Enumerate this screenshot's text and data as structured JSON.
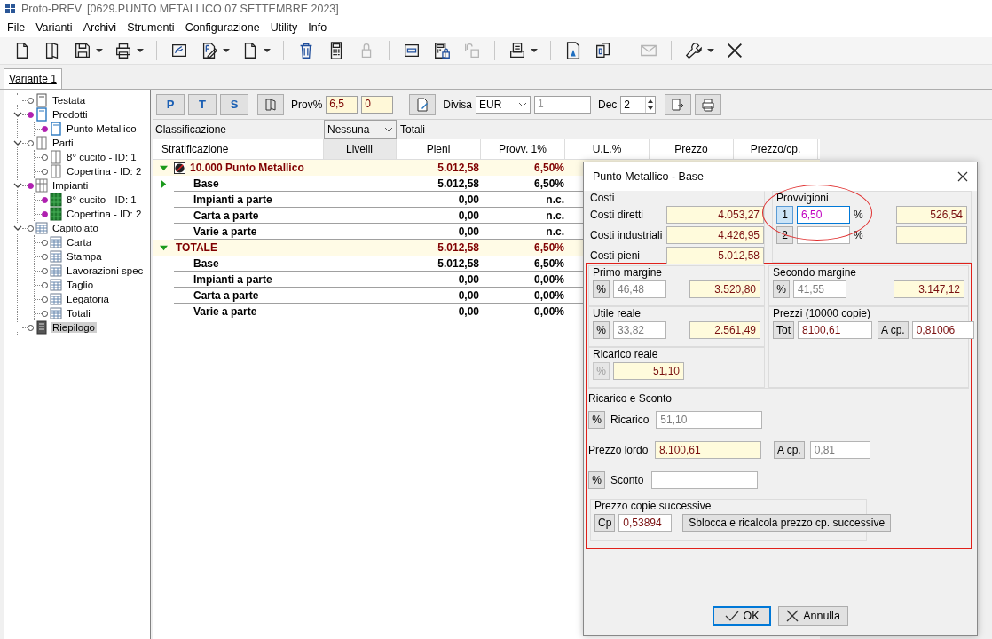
{
  "window": {
    "title": "Proto-PREV",
    "document": "[0629.PUNTO METALLICO 07 SETTEMBRE 2023]"
  },
  "menu": [
    "File",
    "Varianti",
    "Archivi",
    "Strumenti",
    "Configurazione",
    "Utility",
    "Info"
  ],
  "toolbar": [
    {
      "kind": "new",
      "dropdown": false,
      "disabled": false
    },
    {
      "kind": "template",
      "dropdown": false,
      "disabled": false
    },
    {
      "kind": "save",
      "dropdown": true,
      "disabled": false
    },
    {
      "kind": "print",
      "dropdown": true,
      "disabled": false
    },
    {
      "kind": "separator"
    },
    {
      "kind": "sign",
      "dropdown": false,
      "disabled": false
    },
    {
      "kind": "edit",
      "dropdown": true,
      "disabled": false
    },
    {
      "kind": "document",
      "dropdown": true,
      "disabled": false
    },
    {
      "kind": "separator"
    },
    {
      "kind": "trash",
      "dropdown": false,
      "disabled": false
    },
    {
      "kind": "calculator",
      "dropdown": false,
      "disabled": false
    },
    {
      "kind": "lock",
      "dropdown": false,
      "disabled": true
    },
    {
      "kind": "separator"
    },
    {
      "kind": "tag",
      "dropdown": false,
      "disabled": false
    },
    {
      "kind": "calc-lock",
      "dropdown": false,
      "disabled": false
    },
    {
      "kind": "unlock",
      "dropdown": false,
      "disabled": true
    },
    {
      "kind": "separator"
    },
    {
      "kind": "tray",
      "dropdown": true,
      "disabled": false
    },
    {
      "kind": "separator"
    },
    {
      "kind": "doc-mark",
      "dropdown": false,
      "disabled": false
    },
    {
      "kind": "copy",
      "dropdown": false,
      "disabled": false
    },
    {
      "kind": "separator"
    },
    {
      "kind": "mail",
      "dropdown": false,
      "disabled": true
    },
    {
      "kind": "separator"
    },
    {
      "kind": "wrench",
      "dropdown": true,
      "disabled": false
    },
    {
      "kind": "close",
      "dropdown": false,
      "disabled": false
    }
  ],
  "tabs": [
    {
      "label": "Variante 1",
      "selected": true
    }
  ],
  "tree": [
    {
      "label": "Testata",
      "kind": "page",
      "linked": false,
      "selected": false
    },
    {
      "label": "Prodotti",
      "kind": "book",
      "linked": true,
      "selected": false,
      "expanded": true,
      "children": [
        {
          "label": "Punto Metallico -",
          "kind": "book",
          "linked": true,
          "selected": false
        }
      ]
    },
    {
      "label": "Parti",
      "kind": "columns",
      "linked": false,
      "selected": false,
      "expanded": true,
      "children": [
        {
          "label": "8° cucito  - ID: 1",
          "kind": "columns",
          "linked": false,
          "selected": false
        },
        {
          "label": "Copertina - ID: 2",
          "kind": "columns",
          "linked": false,
          "selected": false
        }
      ]
    },
    {
      "label": "Impianti",
      "kind": "grid",
      "linked": true,
      "selected": false,
      "expanded": true,
      "children": [
        {
          "label": "8° cucito  - ID: 1",
          "kind": "green",
          "linked": true,
          "selected": false
        },
        {
          "label": "Copertina - ID: 2",
          "kind": "green",
          "linked": true,
          "selected": false
        }
      ]
    },
    {
      "label": "Capitolato",
      "kind": "table",
      "linked": false,
      "selected": false,
      "expanded": true,
      "children": [
        {
          "label": "Carta",
          "kind": "table",
          "linked": false,
          "selected": false
        },
        {
          "label": "Stampa",
          "kind": "table",
          "linked": false,
          "selected": false
        },
        {
          "label": "Lavorazioni spec",
          "kind": "table",
          "linked": false,
          "selected": false
        },
        {
          "label": "Taglio",
          "kind": "table",
          "linked": false,
          "selected": false
        },
        {
          "label": "Legatoria",
          "kind": "table",
          "linked": false,
          "selected": false
        },
        {
          "label": "Totali",
          "kind": "table",
          "linked": false,
          "selected": false
        }
      ]
    },
    {
      "label": "Riepilogo",
      "kind": "summary",
      "linked": false,
      "selected": true
    }
  ],
  "panel_toolbar": {
    "view_buttons": [
      "P",
      "T",
      "S"
    ],
    "prov_label": "Prov%",
    "prov_values": [
      "6,5",
      "0"
    ],
    "currency_label": "Divisa",
    "currency": "EUR",
    "rate": "1",
    "decimals_label": "Dec",
    "decimals": "2"
  },
  "classification": {
    "label": "Classificazione",
    "value": "Nessuna",
    "mode": "Totali"
  },
  "table": {
    "columns": [
      {
        "label": "Stratificazione",
        "selected": false
      },
      {
        "label": "Livelli",
        "selected": true
      },
      {
        "label": "Pieni",
        "selected": false
      },
      {
        "label": "Provv. 1%",
        "selected": false
      },
      {
        "label": "U.L.%",
        "selected": false
      },
      {
        "label": "Prezzo",
        "selected": false
      },
      {
        "label": "Prezzo/cp.",
        "selected": false
      }
    ],
    "rows": [
      {
        "kind": "group",
        "label": "10.000 Punto Metallico",
        "expandable": true,
        "expanded": true,
        "badge": true,
        "pieni": "5.012,58",
        "provv": "6,50%"
      },
      {
        "kind": "item",
        "label": "Base",
        "expandable": true,
        "expanded": false,
        "badge": false,
        "pieni": "5.012,58",
        "provv": "6,50%"
      },
      {
        "kind": "item",
        "label": "Impianti a parte",
        "expandable": false,
        "badge": false,
        "pieni": "0,00",
        "provv": "n.c."
      },
      {
        "kind": "item",
        "label": "Carta a parte",
        "expandable": false,
        "badge": false,
        "pieni": "0,00",
        "provv": "n.c."
      },
      {
        "kind": "item",
        "label": "Varie a parte",
        "expandable": false,
        "badge": false,
        "pieni": "0,00",
        "provv": "n.c."
      },
      {
        "kind": "group",
        "label": "TOTALE",
        "expandable": true,
        "expanded": true,
        "badge": false,
        "pieni": "5.012,58",
        "provv": "6,50%"
      },
      {
        "kind": "item",
        "label": "Base",
        "expandable": false,
        "badge": false,
        "pieni": "5.012,58",
        "provv": "6,50%"
      },
      {
        "kind": "item",
        "label": "Impianti a parte",
        "expandable": false,
        "badge": false,
        "pieni": "0,00",
        "provv": "0,00%"
      },
      {
        "kind": "item",
        "label": "Carta a parte",
        "expandable": false,
        "badge": false,
        "pieni": "0,00",
        "provv": "0,00%"
      },
      {
        "kind": "item",
        "label": "Varie a parte",
        "expandable": false,
        "badge": false,
        "pieni": "0,00",
        "provv": "0,00%"
      }
    ]
  },
  "dialog": {
    "title": "Punto Metallico - Base",
    "costi": {
      "title": "Costi",
      "rows": [
        {
          "label": "Costi diretti",
          "field": {
            "kind": "result",
            "value": "4.053,27"
          }
        },
        {
          "label": "Costi industriali",
          "field": {
            "kind": "result",
            "value": "4.426,95"
          }
        },
        {
          "label": "Costi pieni",
          "field": {
            "kind": "result",
            "value": "5.012,58"
          }
        }
      ]
    },
    "provvigioni": {
      "title": "Provvigioni",
      "rows": [
        {
          "button": "1",
          "selected": true,
          "percent": {
            "kind": "active",
            "value": "6,50"
          },
          "unit": "%",
          "amount": {
            "kind": "result",
            "value": "526,54"
          }
        },
        {
          "button": "2",
          "selected": false,
          "unit": "%",
          "amount": {
            "kind": "result"
          }
        }
      ]
    },
    "margins": [
      {
        "title": "Primo margine",
        "button": "%",
        "percent": {
          "kind": "derived",
          "value": "46,48"
        },
        "amount": {
          "kind": "result",
          "value": "3.520,80"
        }
      },
      {
        "title": "Secondo margine",
        "button": "%",
        "percent": {
          "kind": "derived",
          "value": "41,55"
        },
        "amount": {
          "kind": "result",
          "value": "3.147,12"
        }
      },
      {
        "title": "Utile reale",
        "button": "%",
        "percent": {
          "kind": "derived",
          "value": "33,82"
        },
        "amount": {
          "kind": "result",
          "value": "2.561,49"
        }
      }
    ],
    "prezzi": {
      "title": "Prezzi (10000 copie)",
      "total_button": "Tot",
      "total": {
        "kind": "input",
        "value": "8100,61"
      },
      "unit_button": "A cp.",
      "unit_price": {
        "kind": "input",
        "value": "0,81006"
      }
    },
    "ricarico_reale": {
      "title": "Ricarico reale",
      "button": "%",
      "button_disabled": true,
      "field": {
        "kind": "result",
        "value": "51,10"
      }
    },
    "ricarico_sconto": {
      "title": "Ricarico e Sconto",
      "ricarico": {
        "button": "%",
        "label": "Ricarico",
        "field": {
          "kind": "derived",
          "value": "51,10"
        }
      },
      "prezzo_lordo": {
        "label": "Prezzo lordo",
        "field": {
          "kind": "total",
          "value": "8.100,61"
        },
        "button": "A cp.",
        "unit_field": {
          "kind": "derived",
          "value": "0,81"
        }
      },
      "sconto": {
        "button": "%",
        "label": "Sconto"
      }
    },
    "copie_successive": {
      "title": "Prezzo copie successive",
      "button": "Cp",
      "field": {
        "kind": "input",
        "value": "0,53894"
      },
      "action": "Sblocca e ricalcola prezzo cp. successive"
    },
    "buttons": [
      {
        "kind": "ok",
        "label": "OK",
        "default": true
      },
      {
        "kind": "cancel",
        "label": "Annulla",
        "default": false
      }
    ]
  }
}
